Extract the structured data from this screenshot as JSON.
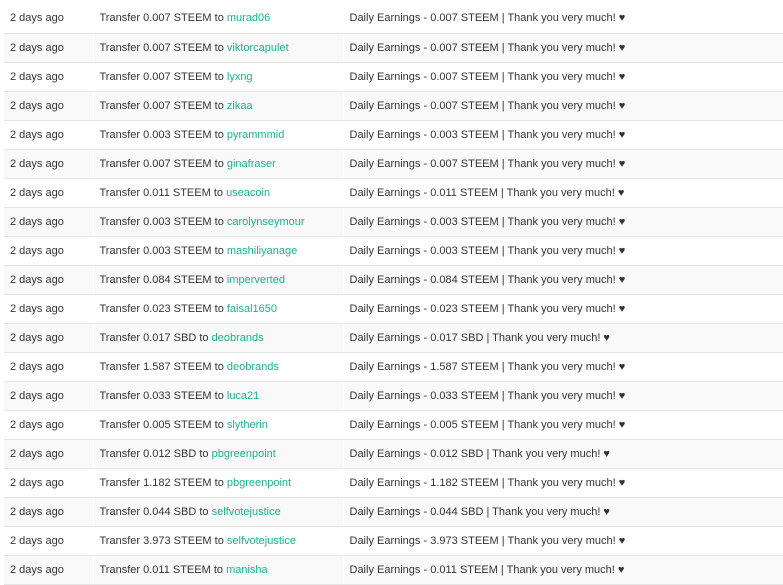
{
  "rows": [
    {
      "when": "2 days ago",
      "op": "Transfer 0.007 STEEM to",
      "account": "murad06",
      "memo": "Daily Earnings - 0.007 STEEM | Thank you very much! ♥"
    },
    {
      "when": "2 days ago",
      "op": "Transfer 0.007 STEEM to",
      "account": "viktorcapulet",
      "memo": "Daily Earnings - 0.007 STEEM | Thank you very much! ♥"
    },
    {
      "when": "2 days ago",
      "op": "Transfer 0.007 STEEM to",
      "account": "lyxng",
      "memo": "Daily Earnings - 0.007 STEEM | Thank you very much! ♥"
    },
    {
      "when": "2 days ago",
      "op": "Transfer 0.007 STEEM to",
      "account": "zikaa",
      "memo": "Daily Earnings - 0.007 STEEM | Thank you very much! ♥"
    },
    {
      "when": "2 days ago",
      "op": "Transfer 0.003 STEEM to",
      "account": "pyrammmid",
      "memo": "Daily Earnings - 0.003 STEEM | Thank you very much! ♥"
    },
    {
      "when": "2 days ago",
      "op": "Transfer 0.007 STEEM to",
      "account": "ginafraser",
      "memo": "Daily Earnings - 0.007 STEEM | Thank you very much! ♥"
    },
    {
      "when": "2 days ago",
      "op": "Transfer 0.011 STEEM to",
      "account": "useacoin",
      "memo": "Daily Earnings - 0.011 STEEM | Thank you very much! ♥"
    },
    {
      "when": "2 days ago",
      "op": "Transfer 0.003 STEEM to",
      "account": "carolynseymour",
      "memo": "Daily Earnings - 0.003 STEEM | Thank you very much! ♥"
    },
    {
      "when": "2 days ago",
      "op": "Transfer 0.003 STEEM to",
      "account": "mashiliyanage",
      "memo": "Daily Earnings - 0.003 STEEM | Thank you very much! ♥"
    },
    {
      "when": "2 days ago",
      "op": "Transfer 0.084 STEEM to",
      "account": "imperverted",
      "memo": "Daily Earnings - 0.084 STEEM | Thank you very much! ♥"
    },
    {
      "when": "2 days ago",
      "op": "Transfer 0.023 STEEM to",
      "account": "faisal1650",
      "memo": "Daily Earnings - 0.023 STEEM | Thank you very much! ♥"
    },
    {
      "when": "2 days ago",
      "op": "Transfer 0.017 SBD to",
      "account": "deobrands",
      "memo": "Daily Earnings - 0.017 SBD | Thank you very much! ♥"
    },
    {
      "when": "2 days ago",
      "op": "Transfer 1.587 STEEM to",
      "account": "deobrands",
      "memo": "Daily Earnings - 1.587 STEEM | Thank you very much! ♥"
    },
    {
      "when": "2 days ago",
      "op": "Transfer 0.033 STEEM to",
      "account": "luca21",
      "memo": "Daily Earnings - 0.033 STEEM | Thank you very much! ♥"
    },
    {
      "when": "2 days ago",
      "op": "Transfer 0.005 STEEM to",
      "account": "slytherin",
      "memo": "Daily Earnings - 0.005 STEEM | Thank you very much! ♥"
    },
    {
      "when": "2 days ago",
      "op": "Transfer 0.012 SBD to",
      "account": "pbgreenpoint",
      "memo": "Daily Earnings - 0.012 SBD | Thank you very much! ♥"
    },
    {
      "when": "2 days ago",
      "op": "Transfer 1.182 STEEM to",
      "account": "pbgreenpoint",
      "memo": "Daily Earnings - 1.182 STEEM | Thank you very much! ♥"
    },
    {
      "when": "2 days ago",
      "op": "Transfer 0.044 SBD to",
      "account": "selfvotejustice",
      "memo": "Daily Earnings - 0.044 SBD | Thank you very much! ♥"
    },
    {
      "when": "2 days ago",
      "op": "Transfer 3.973 STEEM to",
      "account": "selfvotejustice",
      "memo": "Daily Earnings - 3.973 STEEM | Thank you very much! ♥"
    },
    {
      "when": "2 days ago",
      "op": "Transfer 0.011 STEEM to",
      "account": "manisha",
      "memo": "Daily Earnings - 0.011 STEEM | Thank you very much! ♥"
    }
  ]
}
